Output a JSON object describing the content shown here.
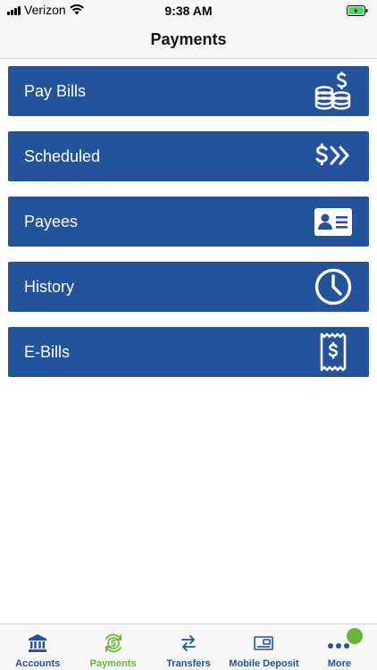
{
  "status_bar": {
    "carrier": "Verizon",
    "time": "9:38 AM"
  },
  "header": {
    "title": "Payments"
  },
  "menu": {
    "items": [
      {
        "label": "Pay Bills",
        "icon": "coins-dollar-icon"
      },
      {
        "label": "Scheduled",
        "icon": "dollar-forward-icon"
      },
      {
        "label": "Payees",
        "icon": "contact-card-icon"
      },
      {
        "label": "History",
        "icon": "clock-icon"
      },
      {
        "label": "E-Bills",
        "icon": "receipt-icon"
      }
    ]
  },
  "tab_bar": {
    "tabs": [
      {
        "label": "Accounts",
        "icon": "bank-icon"
      },
      {
        "label": "Payments",
        "icon": "dollar-cycle-icon",
        "active": true
      },
      {
        "label": "Transfers",
        "icon": "transfer-arrows-icon"
      },
      {
        "label": "Mobile Deposit",
        "icon": "check-deposit-icon"
      },
      {
        "label": "More",
        "icon": "more-dots-icon"
      }
    ]
  },
  "colors": {
    "primary": "#24529b",
    "accent": "#6bb43a",
    "background": "#ffffff"
  }
}
